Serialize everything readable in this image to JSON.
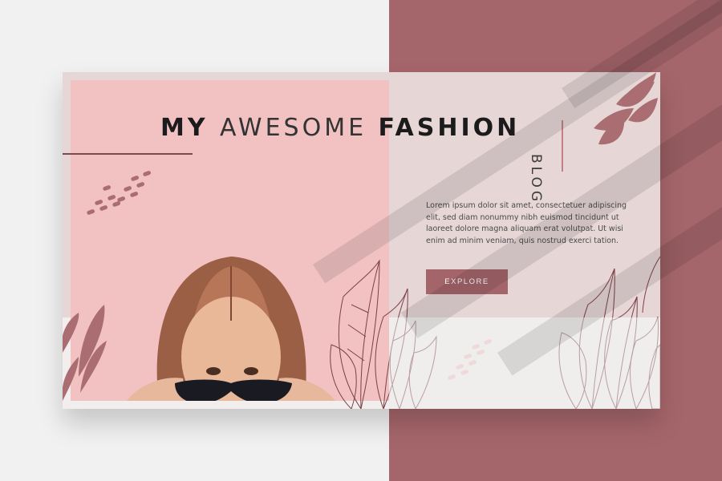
{
  "title": {
    "word1": "MY",
    "word2": "AWESOME",
    "word3": "FASHION",
    "side": "BLOG"
  },
  "body_text": "Lorem ipsum dolor sit amet, consectetuer adipiscing elit, sed diam nonummy nibh euismod tincidunt ut laoreet dolore magna aliquam erat volutpat. Ut wisi enim ad minim veniam, quis nostrud exerci tation.",
  "cta_label": "EXPLORE",
  "colors": {
    "accent": "#a4656a",
    "photo_bg": "#f2c2c3",
    "backdrop_right": "#a5666b",
    "backdrop_left": "#f1f1f1"
  },
  "icons": [
    "leaf-cluster-icon",
    "dot-pattern-icon",
    "line-leaf-icon",
    "sunglasses-icon"
  ]
}
